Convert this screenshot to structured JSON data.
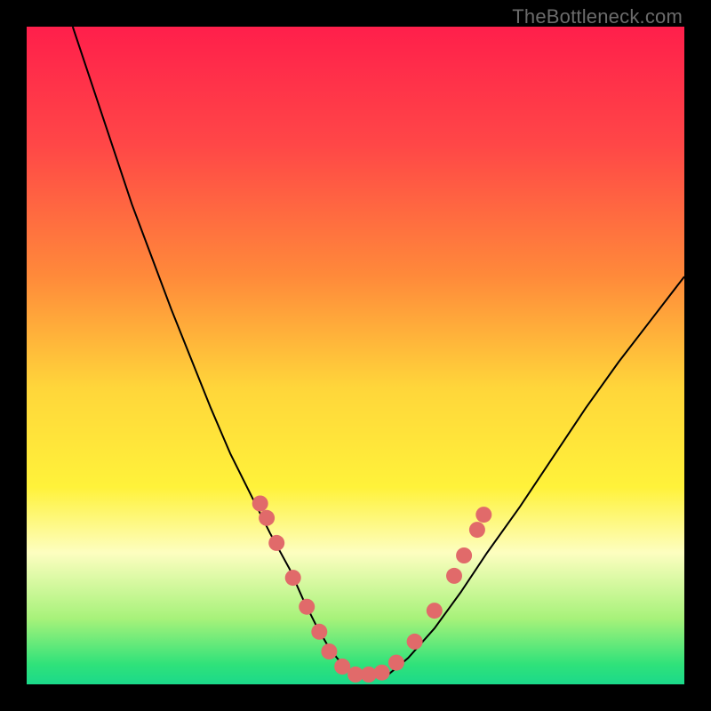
{
  "watermark": "TheBottleneck.com",
  "chart_data": {
    "type": "line",
    "title": "",
    "xlabel": "",
    "ylabel": "",
    "xlim": [
      0,
      100
    ],
    "ylim": [
      0,
      100
    ],
    "grid": false,
    "legend": false,
    "background_gradient_stops": [
      {
        "offset": 0.0,
        "color": "#ff1f4b"
      },
      {
        "offset": 0.18,
        "color": "#ff4747"
      },
      {
        "offset": 0.38,
        "color": "#ff8a3a"
      },
      {
        "offset": 0.55,
        "color": "#ffd63a"
      },
      {
        "offset": 0.7,
        "color": "#fff23a"
      },
      {
        "offset": 0.8,
        "color": "#fdfec0"
      },
      {
        "offset": 0.9,
        "color": "#a7f27a"
      },
      {
        "offset": 0.97,
        "color": "#2fe27a"
      },
      {
        "offset": 1.0,
        "color": "#1bd98a"
      }
    ],
    "series": [
      {
        "name": "bottleneck-curve",
        "stroke": "#000000",
        "stroke_width": 2,
        "x": [
          7,
          10,
          13,
          16,
          19,
          22,
          25,
          28,
          31,
          34,
          37,
          40,
          42,
          44,
          46,
          48,
          50,
          52,
          55,
          58,
          62,
          66,
          70,
          75,
          80,
          85,
          90,
          95,
          100
        ],
        "y": [
          100,
          91,
          82,
          73,
          65,
          57,
          49.5,
          42,
          35,
          29,
          23,
          17.5,
          13,
          9,
          5.5,
          3,
          1.5,
          1,
          1.5,
          4,
          8.5,
          14,
          20,
          27,
          34.5,
          42,
          49,
          55.5,
          62
        ]
      }
    ],
    "markers": {
      "name": "highlight-dots",
      "color": "#e16a6a",
      "radius": 9,
      "points": [
        {
          "x": 35.5,
          "y": 27.5
        },
        {
          "x": 36.5,
          "y": 25.3
        },
        {
          "x": 38.0,
          "y": 21.5
        },
        {
          "x": 40.5,
          "y": 16.2
        },
        {
          "x": 42.6,
          "y": 11.8
        },
        {
          "x": 44.5,
          "y": 8.0
        },
        {
          "x": 46.0,
          "y": 5.0
        },
        {
          "x": 48.0,
          "y": 2.7
        },
        {
          "x": 50.0,
          "y": 1.5
        },
        {
          "x": 52.0,
          "y": 1.5
        },
        {
          "x": 54.0,
          "y": 1.8
        },
        {
          "x": 56.2,
          "y": 3.3
        },
        {
          "x": 59.0,
          "y": 6.5
        },
        {
          "x": 62.0,
          "y": 11.2
        },
        {
          "x": 65.0,
          "y": 16.5
        },
        {
          "x": 66.5,
          "y": 19.6
        },
        {
          "x": 68.5,
          "y": 23.5
        },
        {
          "x": 69.5,
          "y": 25.8
        }
      ]
    }
  }
}
